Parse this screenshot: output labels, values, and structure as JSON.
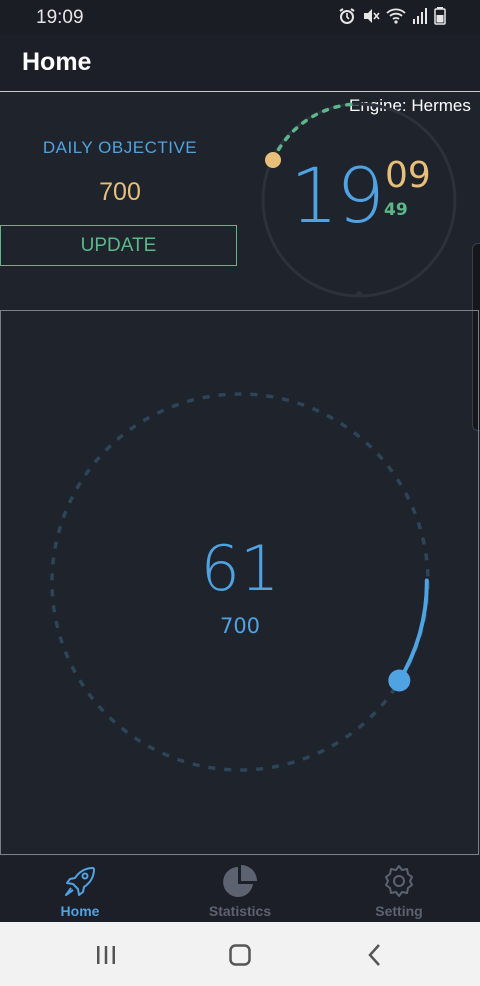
{
  "status_bar": {
    "time": "19:09"
  },
  "app_bar": {
    "title": "Home"
  },
  "engine_label": "Engine: Hermes",
  "objective": {
    "label": "DAILY OBJECTIVE",
    "value": "700",
    "update_label": "UPDATE"
  },
  "clock": {
    "hours": "19",
    "minutes": "09",
    "seconds": "49"
  },
  "progress": {
    "current": "61",
    "target": "700"
  },
  "tabs": [
    {
      "label": "Home",
      "icon": "rocket-icon",
      "active": true
    },
    {
      "label": "Statistics",
      "icon": "pie-chart-icon",
      "active": false
    },
    {
      "label": "Setting",
      "icon": "gear-icon",
      "active": false
    }
  ],
  "colors": {
    "accent_blue": "#4fa3e3",
    "accent_gold": "#e7bf7a",
    "accent_green": "#5bb889",
    "background": "#1f232b",
    "inactive_tab": "#8a8f98"
  }
}
